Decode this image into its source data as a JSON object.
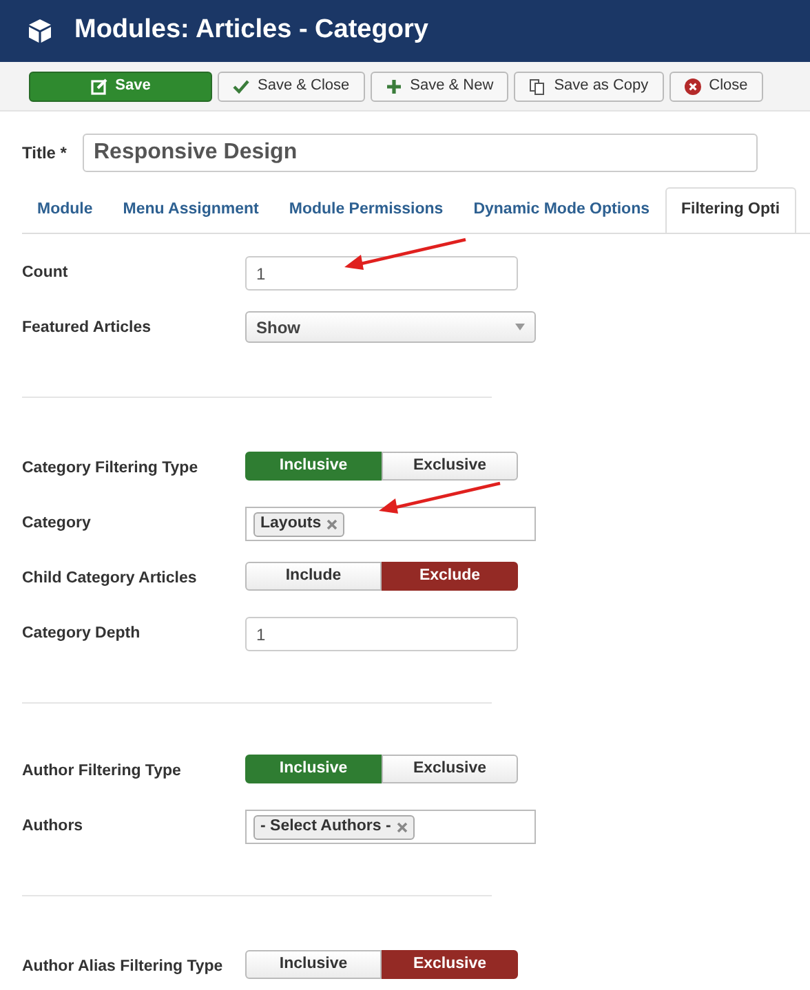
{
  "header": {
    "title": "Modules: Articles - Category"
  },
  "toolbar": [
    {
      "kind": "save",
      "label": "Save"
    },
    {
      "kind": "check",
      "label": "Save & Close"
    },
    {
      "kind": "plus",
      "label": "Save & New"
    },
    {
      "kind": "copy",
      "label": "Save as Copy"
    },
    {
      "kind": "close",
      "label": "Close"
    }
  ],
  "title_field": {
    "label": "Title *",
    "value": "Responsive Design"
  },
  "tabs": [
    {
      "label": "Module",
      "selected": false
    },
    {
      "label": "Menu Assignment",
      "selected": false
    },
    {
      "label": "Module Permissions",
      "selected": false
    },
    {
      "label": "Dynamic Mode Options",
      "selected": false
    },
    {
      "label": "Filtering Opti",
      "selected": true
    }
  ],
  "fields": [
    {
      "kind": "text",
      "label": "Count",
      "value": "1"
    },
    {
      "kind": "select",
      "label": "Featured Articles",
      "value": "Show"
    },
    {
      "kind": "divider"
    },
    {
      "kind": "toggle",
      "label": "Category Filtering Type",
      "options": [
        {
          "label": "Inclusive",
          "selected": true,
          "color": "#2f7d32"
        },
        {
          "label": "Exclusive",
          "selected": false
        }
      ]
    },
    {
      "kind": "tags",
      "label": "Category",
      "tags": [
        "Layouts"
      ]
    },
    {
      "kind": "toggle",
      "label": "Child Category Articles",
      "options": [
        {
          "label": "Include",
          "selected": false
        },
        {
          "label": "Exclude",
          "selected": true,
          "color": "#942a25"
        }
      ]
    },
    {
      "kind": "text",
      "label": "Category Depth",
      "value": "1"
    },
    {
      "kind": "divider"
    },
    {
      "kind": "toggle",
      "label": "Author Filtering Type",
      "options": [
        {
          "label": "Inclusive",
          "selected": true,
          "color": "#2f7d32"
        },
        {
          "label": "Exclusive",
          "selected": false
        }
      ]
    },
    {
      "kind": "tags",
      "label": "Authors",
      "tags": [
        "- Select Authors -"
      ]
    },
    {
      "kind": "divider"
    },
    {
      "kind": "toggle",
      "label": "Author Alias Filtering Type",
      "options": [
        {
          "label": "Inclusive",
          "selected": false
        },
        {
          "label": "Exclusive",
          "selected": true,
          "color": "#942a25"
        }
      ]
    }
  ]
}
